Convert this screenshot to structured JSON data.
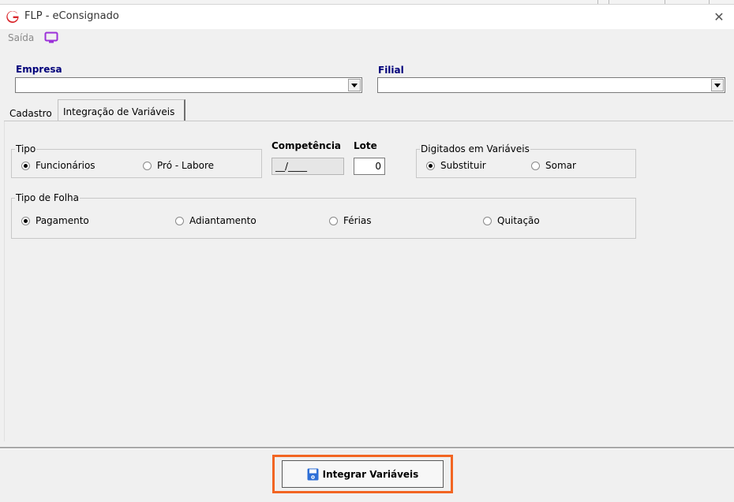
{
  "window": {
    "title": "FLP - eConsignado",
    "close_symbol": "✕"
  },
  "menu": {
    "saida_label": "Saída",
    "monitor_icon": "monitor-icon"
  },
  "empresa": {
    "label": "Empresa",
    "value": ""
  },
  "filial": {
    "label": "Filial",
    "value": ""
  },
  "tabs": [
    {
      "label": "Cadastro",
      "active": false
    },
    {
      "label": "Integração de Variáveis",
      "active": true
    }
  ],
  "tipo": {
    "legend": "Tipo",
    "options": [
      {
        "label": "Funcionários",
        "selected": true
      },
      {
        "label": "Pró - Labore",
        "selected": false
      }
    ]
  },
  "competencia": {
    "label": "Competência",
    "value": "__/____"
  },
  "lote": {
    "label": "Lote",
    "value": "0"
  },
  "digitados": {
    "legend": "Digitados em Variáveis",
    "options": [
      {
        "label": "Substituir",
        "selected": true
      },
      {
        "label": "Somar",
        "selected": false
      }
    ]
  },
  "tipo_folha": {
    "legend": "Tipo de Folha",
    "options": [
      {
        "label": "Pagamento",
        "selected": true
      },
      {
        "label": "Adiantamento",
        "selected": false
      },
      {
        "label": "Férias",
        "selected": false
      },
      {
        "label": "Quitação",
        "selected": false
      }
    ]
  },
  "actions": {
    "integrar_label": "Integrar Variáveis"
  },
  "colors": {
    "label_blue": "#00007a",
    "logo_red": "#d9262b",
    "monitor_purple": "#9b30d9",
    "highlight_orange": "#f26522",
    "save_icon_blue": "#2f6fd6"
  }
}
